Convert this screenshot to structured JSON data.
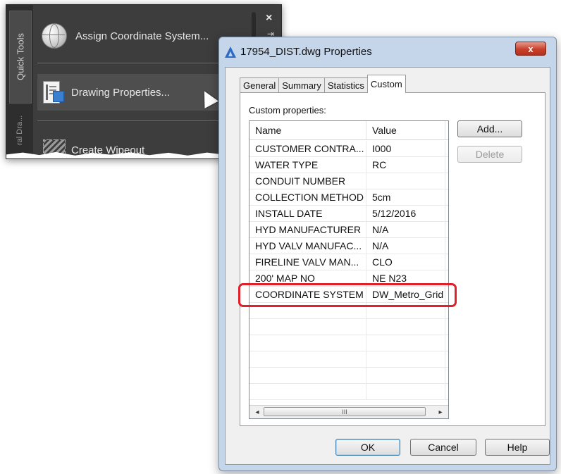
{
  "palette": {
    "tabs": {
      "quick_tools": "Quick Tools",
      "external": "ral Dra..."
    },
    "close_glyph": "×",
    "pin_glyph": "⇥",
    "tools": [
      {
        "label": "Assign Coordinate System...",
        "icon": "globe-icon"
      },
      {
        "label": "Drawing Properties...",
        "icon": "drawing-properties-icon"
      },
      {
        "label": "Create Wipeout",
        "icon": "wipeout-icon"
      }
    ]
  },
  "dialog": {
    "title": "17954_DIST.dwg Properties",
    "close_glyph": "x",
    "tabs": [
      "General",
      "Summary",
      "Statistics",
      "Custom"
    ],
    "active_tab": "Custom",
    "custom_properties_label": "Custom properties:",
    "columns": {
      "name": "Name",
      "value": "Value"
    },
    "rows": [
      {
        "name": "CUSTOMER CONTRA...",
        "value": "I000"
      },
      {
        "name": "WATER TYPE",
        "value": "RC"
      },
      {
        "name": "CONDUIT NUMBER",
        "value": ""
      },
      {
        "name": "COLLECTION METHOD",
        "value": "5cm"
      },
      {
        "name": "INSTALL DATE",
        "value": "5/12/2016"
      },
      {
        "name": "HYD MANUFACTURER",
        "value": "N/A"
      },
      {
        "name": "HYD VALV MANUFAC...",
        "value": "N/A"
      },
      {
        "name": "FIRELINE VALV MAN...",
        "value": "CLO"
      },
      {
        "name": "200' MAP NO",
        "value": "NE N23"
      },
      {
        "name": "COORDINATE SYSTEM",
        "value": "DW_Metro_Grid"
      }
    ],
    "scroll_left": "◂",
    "scroll_right": "▸",
    "scroll_thumb_grip": "III",
    "buttons": {
      "add": "Add...",
      "delete": "Delete",
      "ok": "OK",
      "cancel": "Cancel",
      "help": "Help"
    },
    "colors": {
      "highlight": "#e0202a",
      "title_band": "#c6d6ea",
      "close": "#c8402c"
    }
  }
}
